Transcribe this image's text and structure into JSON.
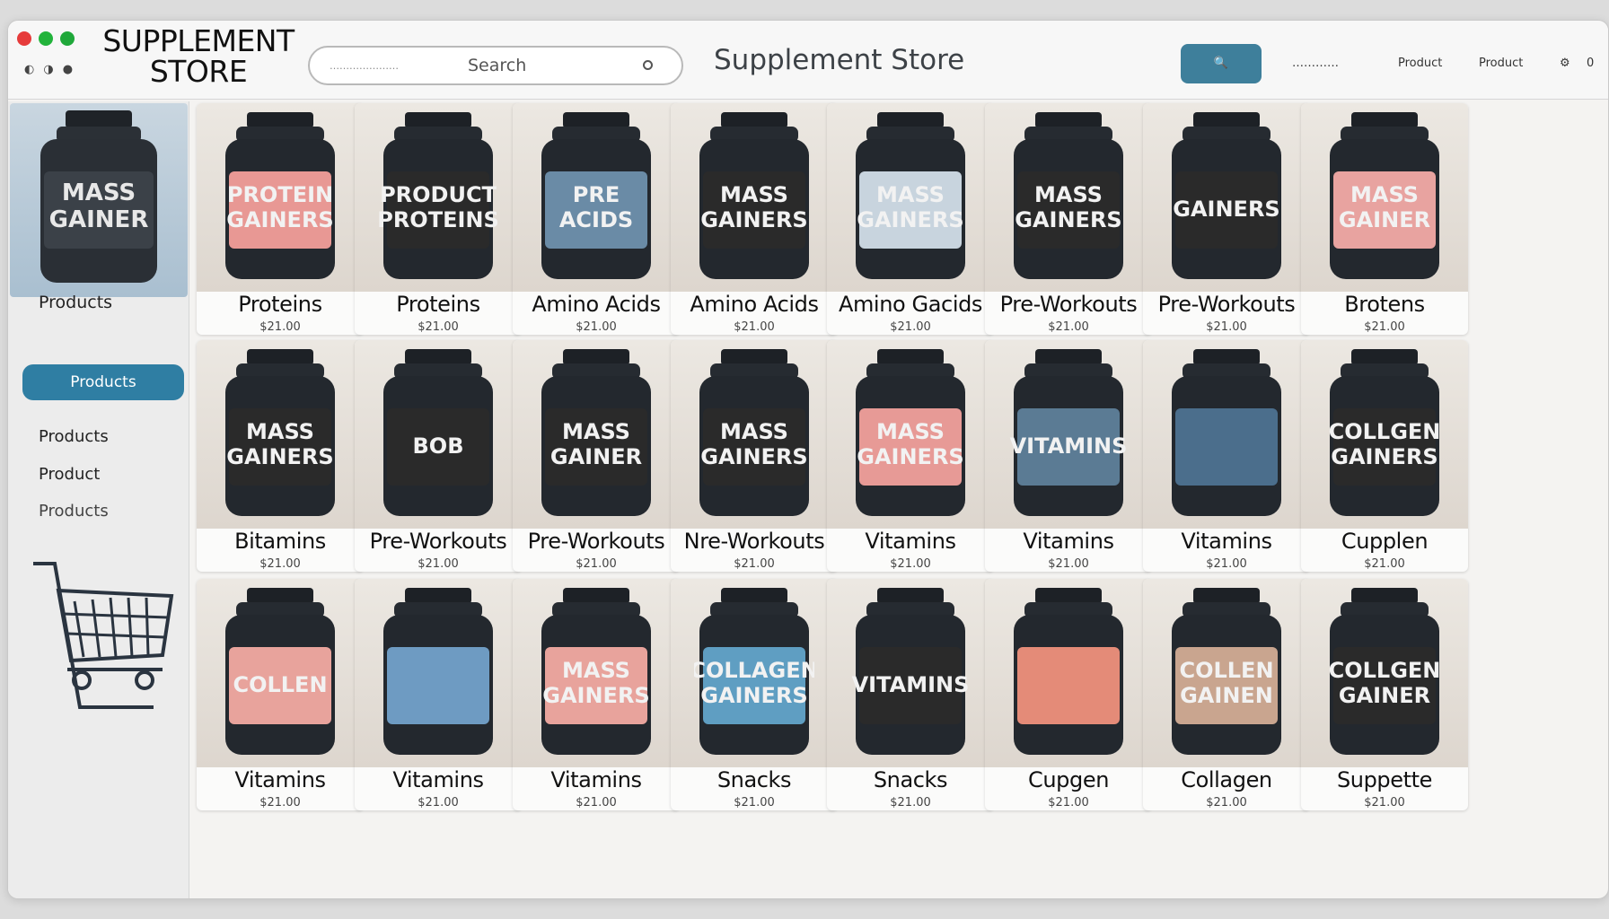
{
  "window": {
    "brand": "SUPPLEMENT STORE",
    "mini_icons": [
      "◐",
      "◑",
      "●"
    ],
    "search": {
      "tiny": "…………………",
      "placeholder": "Search"
    },
    "store_title": "Supplement Store",
    "search_button": "🔍",
    "nav_links": [
      "…………",
      "Product",
      "Product"
    ],
    "nav_icons": [
      "⚙",
      "0"
    ]
  },
  "sidebar": {
    "items": [
      "Products",
      "Products",
      "Products",
      "Product",
      "Products"
    ],
    "active_index": 1,
    "feature_label": "MASS GAINER"
  },
  "products": [
    {
      "name": "Proteins",
      "label": "PROTEIN GAINERS",
      "price": "$21.00",
      "accent": "#e89894"
    },
    {
      "name": "Proteins",
      "label": "PRODUCT PROTEINS",
      "price": "$21.00",
      "accent": "#2a2a2a"
    },
    {
      "name": "Amino Acids",
      "label": "PRE ACIDS",
      "price": "$21.00",
      "accent": "#6a8ba6"
    },
    {
      "name": "Amino Acids",
      "label": "MASS GAINERS",
      "price": "$21.00",
      "accent": "#2a2a2a"
    },
    {
      "name": "Amino Gacids",
      "label": "MASS GAINERS",
      "price": "$21.00",
      "accent": "#c8d4de"
    },
    {
      "name": "Pre-Workouts",
      "label": "MASS GAINERS",
      "price": "$21.00",
      "accent": "#2a2a2a"
    },
    {
      "name": "Pre-Workouts",
      "label": "GAINERS",
      "price": "$21.00",
      "accent": "#2a2a2a"
    },
    {
      "name": "Brotens",
      "label": "MASS GAINER",
      "price": "$21.00",
      "accent": "#e8a3a0"
    },
    {
      "name": "Bitamins",
      "label": "MASS GAINERS",
      "price": "$21.00",
      "accent": "#2a2a2a"
    },
    {
      "name": "Pre-Workouts",
      "label": "BOB",
      "price": "$21.00",
      "accent": "#2a2a2a"
    },
    {
      "name": "Pre-Workouts",
      "label": "MASS GAINER",
      "price": "$21.00",
      "accent": "#2a2a2a"
    },
    {
      "name": "Nre-Workouts",
      "label": "MASS GAINERS",
      "price": "$21.00",
      "accent": "#2a2a2a"
    },
    {
      "name": "Vitamins",
      "label": "MASS GAINERS",
      "price": "$21.00",
      "accent": "#e79a96"
    },
    {
      "name": "Vitamins",
      "label": "VITAMINS",
      "price": "$21.00",
      "accent": "#5b7b94"
    },
    {
      "name": "Vitamins",
      "label": "",
      "price": "$21.00",
      "accent": "#4b6e8c"
    },
    {
      "name": "Cupplen",
      "label": "COLLGEN GAINERS",
      "price": "$21.00",
      "accent": "#2a2a2a"
    },
    {
      "name": "Vitamins",
      "label": "COLLEN",
      "price": "$21.00",
      "accent": "#e8a39c"
    },
    {
      "name": "Vitamins",
      "label": "",
      "price": "$21.00",
      "accent": "#6e9bc2"
    },
    {
      "name": "Vitamins",
      "label": "MASS GAINERS",
      "price": "$21.00",
      "accent": "#e8a39c"
    },
    {
      "name": "Snacks",
      "label": "COLLAGEN GAINERS",
      "price": "$21.00",
      "accent": "#5f9ec2"
    },
    {
      "name": "Snacks",
      "label": "VITAMINS",
      "price": "$21.00",
      "accent": "#2a2a2a"
    },
    {
      "name": "Cupgen",
      "label": "",
      "price": "$21.00",
      "accent": "#e48b78"
    },
    {
      "name": "Collagen",
      "label": "COLLEN GAINEN",
      "price": "$21.00",
      "accent": "#c9a58f"
    },
    {
      "name": "Suppette",
      "label": "COLLGEN GAINER",
      "price": "$21.00",
      "accent": "#2a2a2a"
    }
  ]
}
